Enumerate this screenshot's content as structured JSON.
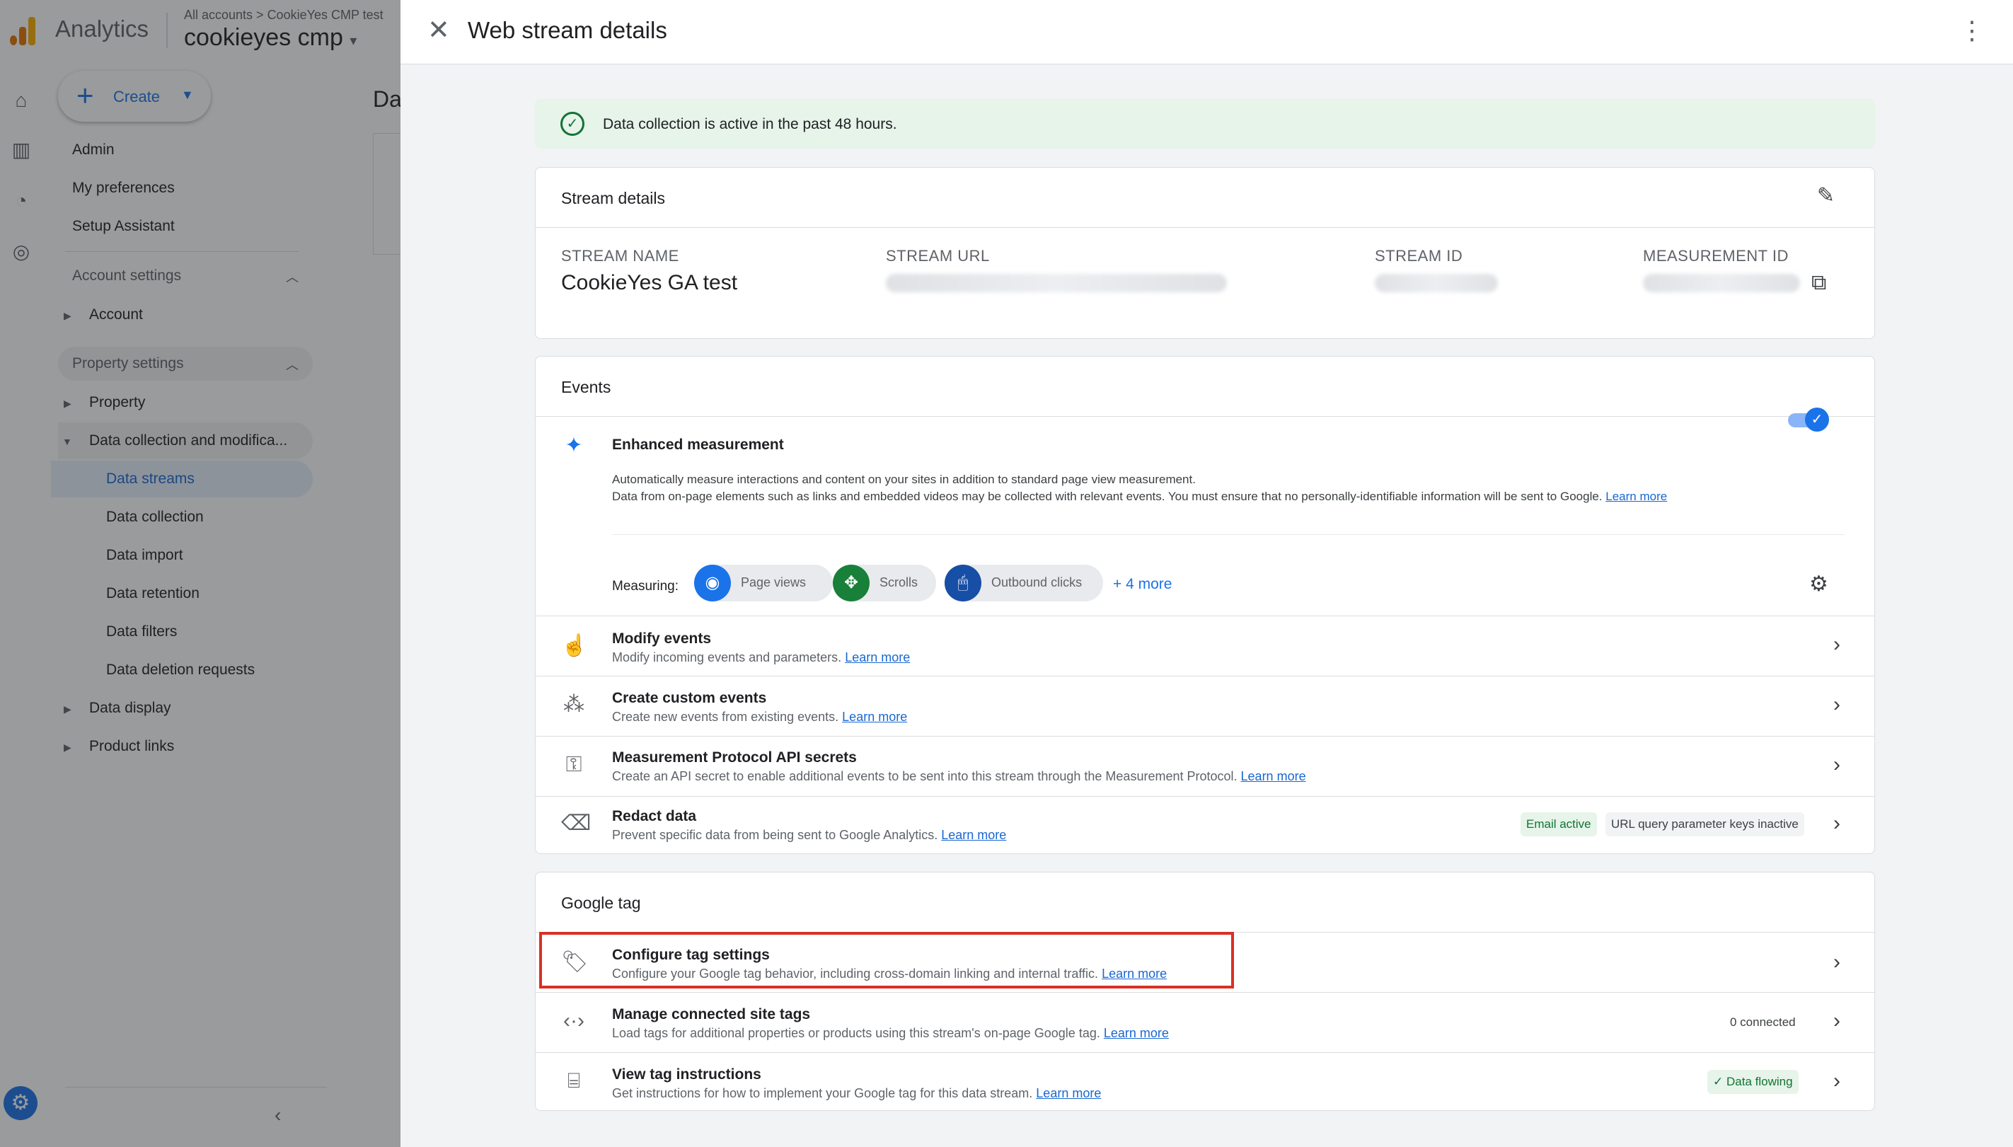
{
  "app": {
    "brand": "Analytics",
    "breadcrumb": "All accounts > CookieYes CMP test",
    "property": "cookieyes cmp",
    "property_caret": "▾"
  },
  "left_nav": {
    "create_label": "Create",
    "items": [
      "Admin",
      "My preferences",
      "Setup Assistant"
    ],
    "account_section": "Account settings",
    "account_items": [
      "Account"
    ],
    "property_section": "Property settings",
    "property_items": [
      "Property",
      "Data collection and modifica..."
    ],
    "data_collection_items": [
      "Data streams",
      "Data collection",
      "Data import",
      "Data retention",
      "Data filters",
      "Data deletion requests"
    ],
    "other_items": [
      "Data display",
      "Product links"
    ],
    "background_page_title": "Da"
  },
  "panel": {
    "title": "Web stream details",
    "banner": "Data collection is active in the past 48 hours.",
    "stream_details": {
      "heading": "Stream details",
      "fields": [
        {
          "label": "STREAM NAME",
          "value": "CookieYes GA test"
        },
        {
          "label": "STREAM URL",
          "value": ""
        },
        {
          "label": "STREAM ID",
          "value": ""
        },
        {
          "label": "MEASUREMENT ID",
          "value": ""
        }
      ]
    },
    "events": {
      "heading": "Events",
      "enhanced": {
        "title": "Enhanced measurement",
        "line1": "Automatically measure interactions and content on your sites in addition to standard page view measurement.",
        "line2": "Data from on-page elements such as links and embedded videos may be collected with relevant events. You must ensure that no personally-identifiable information will be sent to Google.",
        "learn_more": "Learn more",
        "enabled": true,
        "measuring_label": "Measuring:",
        "measures": [
          "Page views",
          "Scrolls",
          "Outbound clicks"
        ],
        "more": "+ 4 more"
      },
      "rows": [
        {
          "title": "Modify events",
          "sub": "Modify incoming events and parameters.",
          "link": "Learn more",
          "icon": "touch-icon"
        },
        {
          "title": "Create custom events",
          "sub": "Create new events from existing events.",
          "link": "Learn more",
          "icon": "sparkle-click-icon"
        },
        {
          "title": "Measurement Protocol API secrets",
          "sub": "Create an API secret to enable additional events to be sent into this stream through the Measurement Protocol.",
          "link": "Learn more",
          "icon": "key-icon"
        },
        {
          "title": "Redact data",
          "sub": "Prevent specific data from being sent to Google Analytics.",
          "link": "Learn more",
          "icon": "eraser-icon",
          "chips": [
            "Email active",
            "URL query parameter keys inactive"
          ]
        }
      ]
    },
    "google_tag": {
      "heading": "Google tag",
      "rows": [
        {
          "title": "Configure tag settings",
          "sub": "Configure your Google tag behavior, including cross-domain linking and internal traffic.",
          "link": "Learn more"
        },
        {
          "title": "Manage connected site tags",
          "sub": "Load tags for additional properties or products using this stream's on-page Google tag.",
          "link": "Learn more",
          "badge": "0 connected"
        },
        {
          "title": "View tag instructions",
          "sub": "Get instructions for how to implement your Google tag for this data stream.",
          "link": "Learn more",
          "badge": "Data flowing"
        }
      ]
    }
  },
  "colors": {
    "accent": "#1a73e8",
    "success": "#137333",
    "highlight": "#d93025"
  }
}
